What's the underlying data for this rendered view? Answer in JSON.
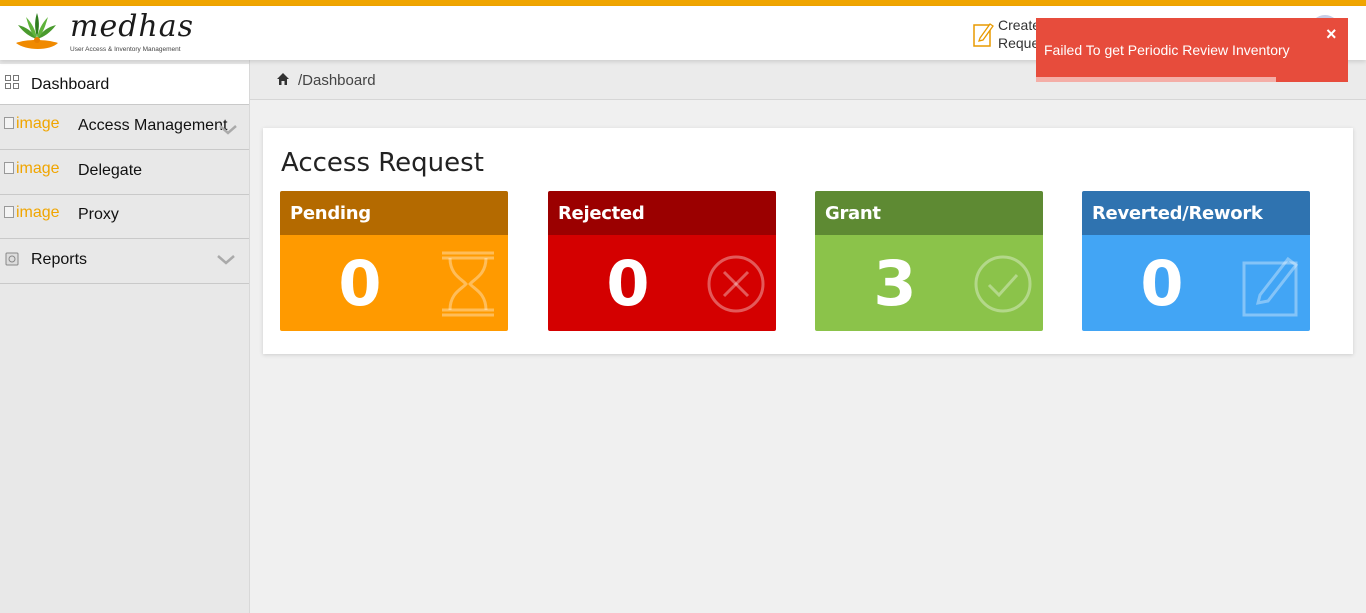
{
  "colors": {
    "accent": "#f0a500",
    "pending": "#ff9a00",
    "pending_head": "#b46a00",
    "rejected": "#d40000",
    "rejected_head": "#9b0000",
    "grant": "#8bc34a",
    "grant_head": "#5e8a33",
    "reverted": "#42a5f5",
    "reverted_head": "#2f73b0",
    "toast": "#e74c3c"
  },
  "header": {
    "logo_word": "medhas",
    "logo_tagline": "User Access & Inventory Management",
    "create_request_label": "Create\nRequest",
    "create_request_icon": "edit-icon",
    "avatar_icon": "user-avatar"
  },
  "toast": {
    "message": "Failed To get Periodic Review Inventory",
    "close_label": "×"
  },
  "sidebar": {
    "items": [
      {
        "label": "Dashboard",
        "icon": "grid-icon"
      },
      {
        "label": "Access Management",
        "broken_alt": "image"
      },
      {
        "label": "Delegate",
        "broken_alt": "image"
      },
      {
        "label": "Proxy",
        "broken_alt": "image"
      },
      {
        "label": "Reports",
        "icon": "reports-icon"
      }
    ]
  },
  "breadcrumb": {
    "path": "/Dashboard",
    "icon": "home-icon"
  },
  "panel": {
    "title": "Access Request",
    "cards": [
      {
        "title": "Pending",
        "value": "0",
        "icon": "hourglass-icon"
      },
      {
        "title": "Rejected",
        "value": "0",
        "icon": "x-circle-icon"
      },
      {
        "title": "Grant",
        "value": "3",
        "icon": "check-circle-icon"
      },
      {
        "title": "Reverted/Rework",
        "value": "0",
        "icon": "edit-square-icon"
      }
    ]
  }
}
